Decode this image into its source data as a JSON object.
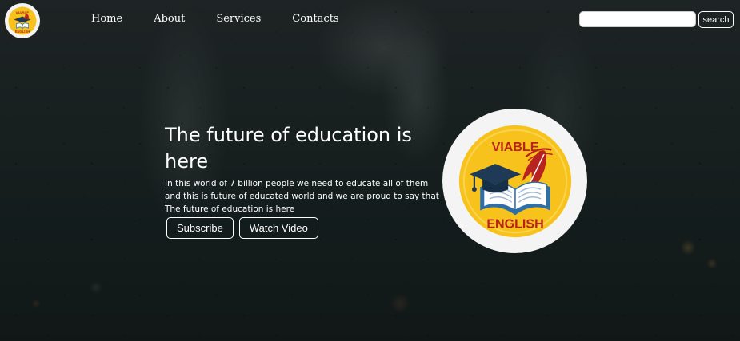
{
  "nav": {
    "links": [
      "Home",
      "About",
      "Services",
      "Contacts"
    ],
    "search_placeholder": "",
    "search_value": "",
    "search_button": "search"
  },
  "hero": {
    "title": "The future of education is here",
    "text": "In this world of 7 billion people we need to educate all of them and this is future of educated world and we are proud to say that The future of education is here",
    "buttons": [
      "Subscribe",
      "Watch Video"
    ]
  },
  "logo": {
    "top_text": "VIABLE",
    "bottom_text": "ENGLISH"
  },
  "colors": {
    "logo_yellow": "#f7c21b",
    "logo_red": "#b8231f",
    "cap_navy": "#1f3a56",
    "book_blue": "#2e6fa8"
  },
  "icons": [
    "graduation-cap-icon",
    "quill-icon",
    "open-book-icon"
  ]
}
